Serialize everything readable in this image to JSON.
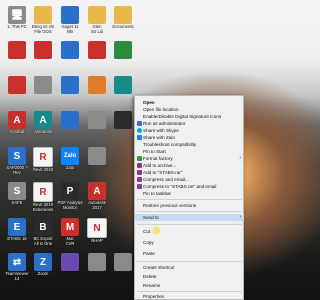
{
  "desktop": {
    "row1": [
      {
        "label": "1. This PC",
        "icon": "this-pc-icon"
      },
      {
        "label": "Đồng số chí\nFile OOS",
        "icon": "folder-icon"
      },
      {
        "label": "Gaget 11\nNhi",
        "icon": "app-icon"
      },
      {
        "label": "Gắm\nSở Lùi",
        "icon": "folder-icon"
      },
      {
        "label": "Documents",
        "icon": "folder-icon"
      }
    ],
    "row2": [
      {
        "label": "",
        "icon": "app-red-icon"
      },
      {
        "label": "",
        "icon": "app-red-icon"
      },
      {
        "label": "",
        "icon": "app-blue-icon"
      },
      {
        "label": "",
        "icon": "app-red-icon"
      },
      {
        "label": "",
        "icon": "app-green-icon"
      }
    ],
    "row3": [
      {
        "label": "",
        "icon": "app-red-icon"
      },
      {
        "label": "",
        "icon": "app-grey-icon"
      },
      {
        "label": "",
        "icon": "app-blue-icon"
      },
      {
        "label": "",
        "icon": "app-orange-icon"
      },
      {
        "label": "",
        "icon": "app-teal-icon"
      }
    ],
    "row4": [
      {
        "label": "Acrobat",
        "icon": "acrobat-icon"
      },
      {
        "label": "Autodesk",
        "icon": "autodesk-icon"
      },
      {
        "label": "",
        "icon": "app-blue-icon"
      },
      {
        "label": "",
        "icon": "app-grey-icon"
      },
      {
        "label": "",
        "icon": "app-dark-icon"
      }
    ],
    "row5": [
      {
        "label": "SAP2000 ?\nRev",
        "icon": "sap-icon"
      },
      {
        "label": "Revit 2019",
        "icon": "revit-icon"
      },
      {
        "label": "Zalo",
        "icon": "zalo-icon"
      },
      {
        "label": "",
        "icon": "app-grey-icon"
      }
    ],
    "row6": [
      {
        "label": "SAFE",
        "icon": "safe-icon"
      },
      {
        "label": "Revit 2019\nExtensions",
        "icon": "revit-icon"
      },
      {
        "label": "PDF Analysis\nMonitor",
        "icon": "pdf-icon"
      },
      {
        "label": "Autodesk\n2017",
        "icon": "autodesk-icon"
      }
    ],
    "row7": [
      {
        "label": "ETABS 18",
        "icon": "etabs-icon"
      },
      {
        "label": "BC Export\nAll in One",
        "icon": "bc-icon"
      },
      {
        "label": "Mat\nCVR",
        "icon": "mat-icon"
      },
      {
        "label": "NHAP",
        "icon": "nhap-icon"
      }
    ],
    "row8": [
      {
        "label": "TeamViewer\n14",
        "icon": "teamviewer-icon"
      },
      {
        "label": "Zoom",
        "icon": "zoom-icon"
      },
      {
        "label": "",
        "icon": "app-purple-icon"
      },
      {
        "label": "",
        "icon": "app-grey-icon"
      },
      {
        "label": "",
        "icon": "app-grey-icon"
      }
    ]
  },
  "menu": {
    "items": [
      {
        "label": "Open",
        "icon": "",
        "arrow": ""
      },
      {
        "label": "Open file location",
        "icon": "",
        "arrow": ""
      },
      {
        "label": "Enable/Disable Digital Signature Icons",
        "icon": "",
        "arrow": ""
      },
      {
        "label": "Run as administrator",
        "icon": "shield-icon",
        "arrow": ""
      },
      {
        "label": "Share with Skype",
        "icon": "skype-icon",
        "arrow": ""
      },
      {
        "label": "Share with Zalo",
        "icon": "zalo-icon",
        "arrow": ""
      },
      {
        "label": "Troubleshoot compatibility",
        "icon": "",
        "arrow": ""
      },
      {
        "label": "Pin to Start",
        "icon": "",
        "arrow": ""
      },
      {
        "label": "Format factory",
        "icon": "format-factory-icon",
        "arrow": "›"
      },
      {
        "label": "Add to archive...",
        "icon": "winrar-icon",
        "arrow": ""
      },
      {
        "label": "Add to \"STABS.rar\"",
        "icon": "winrar-icon",
        "arrow": ""
      },
      {
        "label": "Compress and email...",
        "icon": "winrar-icon",
        "arrow": ""
      },
      {
        "label": "Compress to \"STABS.rar\" and email",
        "icon": "winrar-icon",
        "arrow": ""
      },
      {
        "label": "Pin to taskbar",
        "icon": "",
        "arrow": ""
      },
      {
        "label": "Restore previous versions",
        "icon": "",
        "arrow": ""
      },
      {
        "label": "Send to",
        "icon": "",
        "arrow": "›"
      },
      {
        "label": "Cut",
        "icon": "",
        "arrow": ""
      },
      {
        "label": "Copy",
        "icon": "",
        "arrow": ""
      },
      {
        "label": "Paste",
        "icon": "",
        "arrow": ""
      },
      {
        "label": "Create shortcut",
        "icon": "",
        "arrow": ""
      },
      {
        "label": "Delete",
        "icon": "",
        "arrow": ""
      },
      {
        "label": "Rename",
        "icon": "",
        "arrow": ""
      },
      {
        "label": "Properties",
        "icon": "",
        "arrow": ""
      }
    ],
    "highlighted_index": 15
  },
  "colors": {
    "menu_bg": "#f0f0f0",
    "highlight": "#c7dcf2",
    "cursor": "#f6e36a"
  }
}
